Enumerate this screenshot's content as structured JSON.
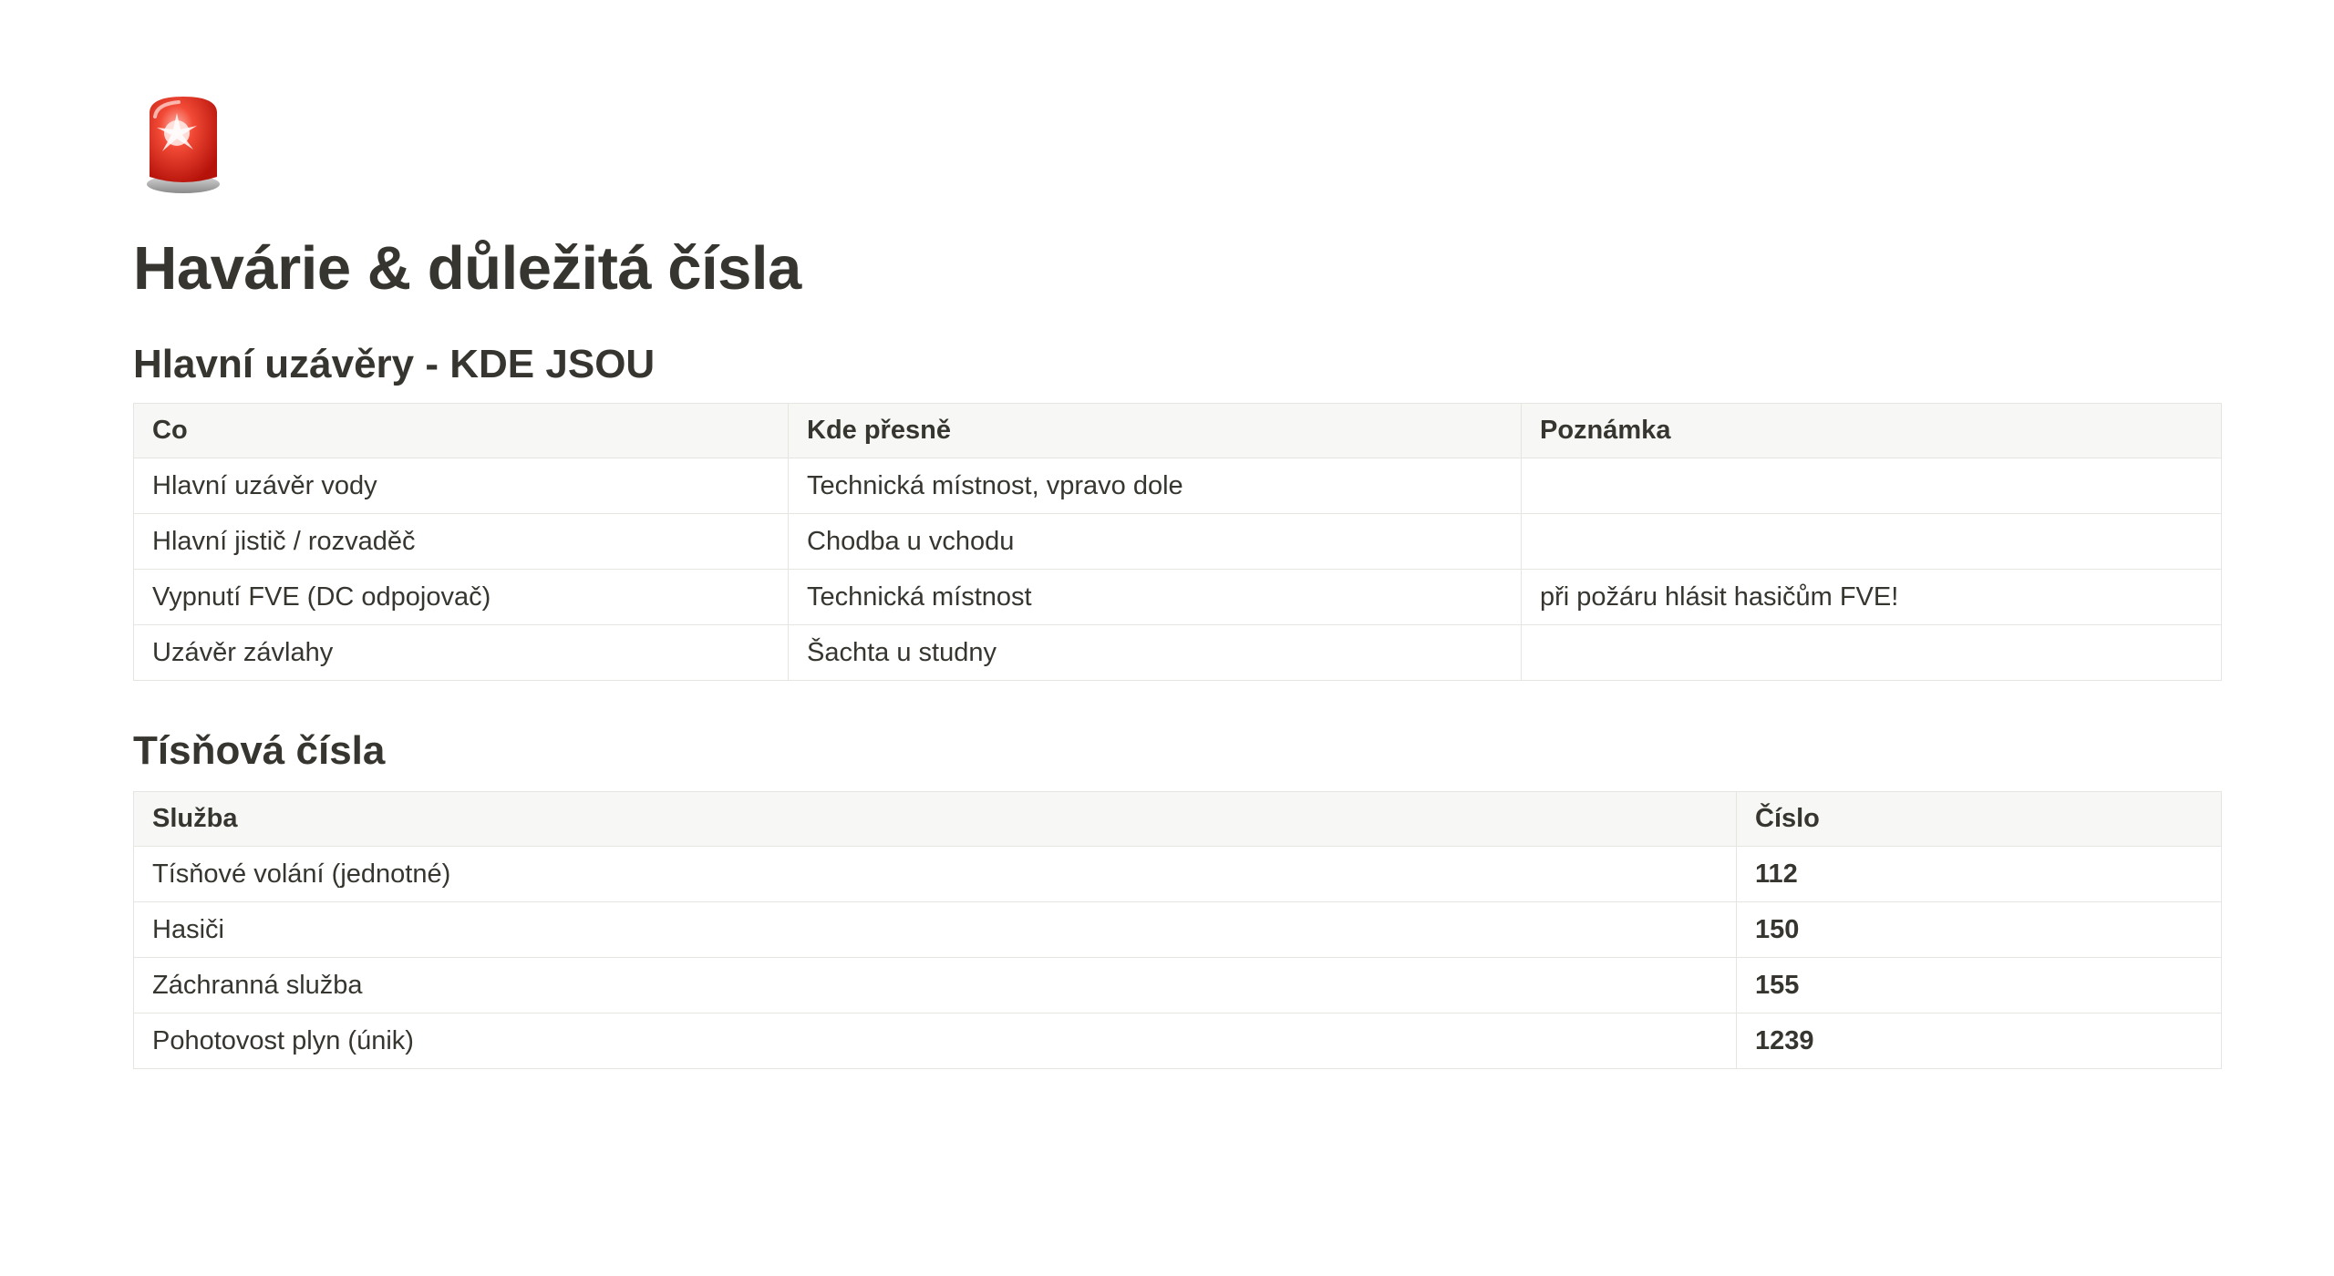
{
  "page": {
    "icon": "police-car-light-icon",
    "title": "Havárie & důležitá čísla"
  },
  "shutoffs": {
    "heading": "Hlavní uzávěry - KDE JSOU",
    "columns": [
      "Co",
      "Kde přesně",
      "Poznámka"
    ],
    "rows": [
      [
        "Hlavní uzávěr vody",
        "Technická místnost, vpravo dole",
        ""
      ],
      [
        "Hlavní jistič / rozvaděč",
        "Chodba u vchodu",
        ""
      ],
      [
        "Vypnutí FVE (DC odpojovač)",
        "Technická místnost",
        "při požáru hlásit hasičům FVE!"
      ],
      [
        "Uzávěr závlahy",
        "Šachta u studny",
        ""
      ]
    ]
  },
  "emergency": {
    "heading": "Tísňová čísla",
    "columns": [
      "Služba",
      "Číslo"
    ],
    "rows": [
      [
        "Tísňové volání (jednotné)",
        "112"
      ],
      [
        "Hasiči",
        "150"
      ],
      [
        "Záchranná služba",
        "155"
      ],
      [
        "Pohotovost plyn (únik)",
        "1239"
      ]
    ]
  },
  "colors": {
    "text": "#37352f",
    "header_bg": "#f7f7f5",
    "border": "#e6e5e2",
    "siren_red": "#e0261a"
  }
}
